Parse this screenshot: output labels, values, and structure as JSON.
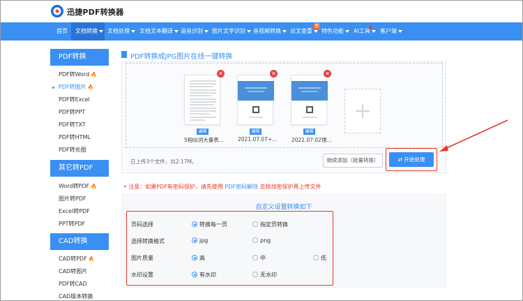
{
  "brand": {
    "name": "迅捷PDF转换器"
  },
  "nav": {
    "items": [
      {
        "label": "首页",
        "caret": false
      },
      {
        "label": "文档转换",
        "caret": true,
        "active": true
      },
      {
        "label": "文档处理",
        "caret": true
      },
      {
        "label": "文档文本翻译",
        "caret": true
      },
      {
        "label": "语音识别",
        "caret": true
      },
      {
        "label": "图片文字识别",
        "caret": true
      },
      {
        "label": "音视频转换",
        "caret": true
      },
      {
        "label": "论文查重",
        "caret": true,
        "badge": "新"
      },
      {
        "label": "特色功能",
        "caret": true
      },
      {
        "label": "AI工具",
        "caret": true
      },
      {
        "label": "客户端",
        "caret": true
      }
    ]
  },
  "sidebar": {
    "sections": [
      {
        "title": "PDF转换",
        "items": [
          {
            "label": "PDF转Word",
            "hot": true
          },
          {
            "label": "PDF转图片",
            "hot": true,
            "active": true
          },
          {
            "label": "PDF转Excel"
          },
          {
            "label": "PDF转PPT"
          },
          {
            "label": "PDF转TXT"
          },
          {
            "label": "PDF转HTML"
          },
          {
            "label": "PDF转长图"
          }
        ]
      },
      {
        "title": "其它转PDF",
        "items": [
          {
            "label": "Word转PDF",
            "hot": true
          },
          {
            "label": "图片转PDF"
          },
          {
            "label": "Excel转PDF"
          },
          {
            "label": "PPT转PDF"
          }
        ]
      },
      {
        "title": "CAD转换",
        "items": [
          {
            "label": "CAD转PDF",
            "hot": true
          },
          {
            "label": "CAD转图片"
          },
          {
            "label": "PDF转CAD"
          },
          {
            "label": "CAD版本转换"
          }
        ]
      }
    ]
  },
  "main": {
    "title": "PDF转换成JPG图片在线一键转换",
    "files": [
      {
        "name": "5相似词大量表...",
        "edit": "编辑"
      },
      {
        "name": "2021.07.07+...",
        "edit": "编辑"
      },
      {
        "name": "2021.07.02理...",
        "edit": "编辑"
      }
    ],
    "upload_info": "已上传3个文件，共2.17M。",
    "continue_label": "继续添加（批量转换）",
    "start_label": "开始处理",
    "notice": {
      "prefix": "注意：如果PDF有密码保护，请先使用",
      "link": "PDF密码解除",
      "suffix": "去除加密保护再上传文件"
    }
  },
  "settings": {
    "title": "自定义设置转换如下",
    "rows": [
      {
        "label": "页码选择",
        "options": [
          {
            "label": "转换每一页",
            "selected": true
          },
          {
            "label": "指定页转换",
            "selected": false
          }
        ]
      },
      {
        "label": "选择转换格式",
        "options": [
          {
            "label": "jpg",
            "selected": true
          },
          {
            "label": "png",
            "selected": false
          }
        ]
      },
      {
        "label": "图片质量",
        "options": [
          {
            "label": "高",
            "selected": true
          },
          {
            "label": "中",
            "selected": false
          },
          {
            "label": "低",
            "selected": false
          }
        ]
      },
      {
        "label": "水印设置",
        "options": [
          {
            "label": "有水印",
            "selected": true
          },
          {
            "label": "无水印",
            "selected": false
          }
        ]
      }
    ]
  },
  "colors": {
    "accent": "#3a8ff2",
    "highlight": "#e8382a",
    "hot": "#f07a3a"
  },
  "icons": [
    "logo-icon",
    "fire-icon",
    "document-icon",
    "delete-icon",
    "plus-icon",
    "swap-icon",
    "caret-down-icon",
    "annotation-arrow"
  ]
}
